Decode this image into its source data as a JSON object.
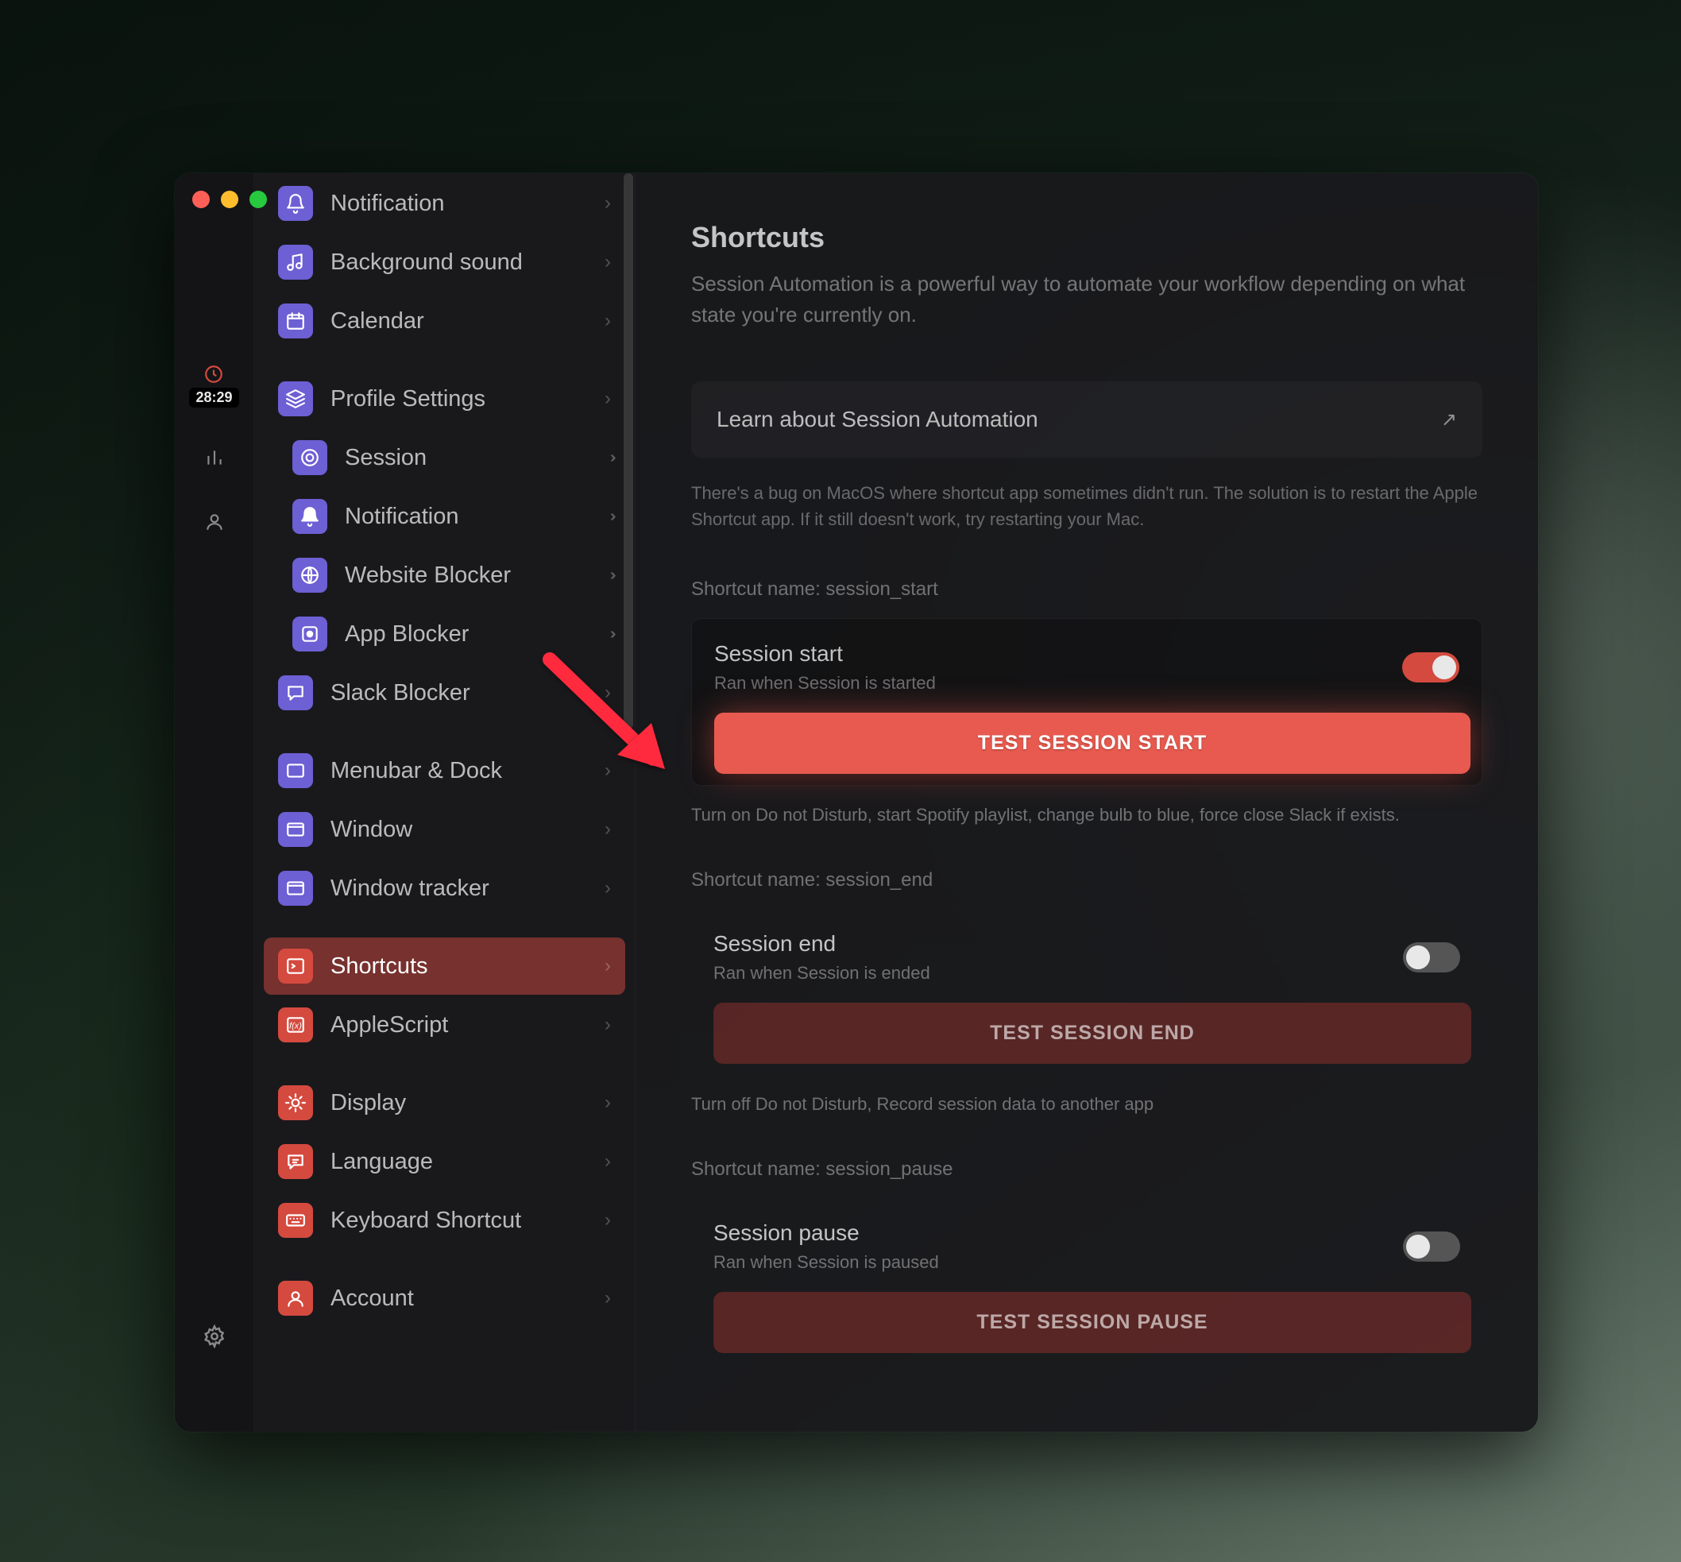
{
  "slim": {
    "timer": "28:29"
  },
  "sidebar": {
    "items": [
      {
        "label": "Notification",
        "icon": "bell-icon",
        "color": "purple",
        "chev": "single"
      },
      {
        "label": "Background sound",
        "icon": "music-icon",
        "color": "purple",
        "chev": "single"
      },
      {
        "label": "Calendar",
        "icon": "calendar-icon",
        "color": "purple",
        "chev": "single"
      },
      {
        "gap": true
      },
      {
        "label": "Profile Settings",
        "icon": "layers-icon",
        "color": "purple",
        "chev": "single"
      },
      {
        "label": "Session",
        "icon": "target-icon",
        "color": "purple",
        "chev": "double",
        "sub": true
      },
      {
        "label": "Notification",
        "icon": "bell-solid-icon",
        "color": "purple",
        "chev": "double",
        "sub": true
      },
      {
        "label": "Website Blocker",
        "icon": "globe-icon",
        "color": "purple",
        "chev": "double",
        "sub": true
      },
      {
        "label": "App Blocker",
        "icon": "app-icon",
        "color": "purple",
        "chev": "double",
        "sub": true
      },
      {
        "label": "Slack Blocker",
        "icon": "chat-icon",
        "color": "purple",
        "chev": "single"
      },
      {
        "gap": true
      },
      {
        "label": "Menubar & Dock",
        "icon": "window-icon",
        "color": "purple",
        "chev": "single"
      },
      {
        "label": "Window",
        "icon": "window2-icon",
        "color": "purple",
        "chev": "single"
      },
      {
        "label": "Window tracker",
        "icon": "window3-icon",
        "color": "purple",
        "chev": "single"
      },
      {
        "gap": true
      },
      {
        "label": "Shortcuts",
        "icon": "terminal-icon",
        "color": "red",
        "chev": "single",
        "active": true
      },
      {
        "label": "AppleScript",
        "icon": "fx-icon",
        "color": "red",
        "chev": "single"
      },
      {
        "gap": true
      },
      {
        "label": "Display",
        "icon": "brightness-icon",
        "color": "red",
        "chev": "single"
      },
      {
        "label": "Language",
        "icon": "speech-icon",
        "color": "red",
        "chev": "single"
      },
      {
        "label": "Keyboard Shortcut",
        "icon": "keyboard-icon",
        "color": "red",
        "chev": "single"
      },
      {
        "gap": true
      },
      {
        "label": "Account",
        "icon": "user-icon",
        "color": "red",
        "chev": "single"
      }
    ]
  },
  "content": {
    "title": "Shortcuts",
    "description": "Session Automation is a powerful way to automate your workflow depending on what state you're currently on.",
    "learn_label": "Learn about Session Automation",
    "bug_note": "There's a bug on MacOS where shortcut app sometimes didn't run. The solution is to restart the Apple Shortcut app. If it still doesn't work, try restarting your Mac.",
    "sections": [
      {
        "name_label": "Shortcut name: session_start",
        "title": "Session start",
        "subtitle": "Ran when Session is started",
        "toggle_on": true,
        "button": "TEST SESSION START",
        "primary": true,
        "highlighted": true,
        "hint": "Turn on Do not Disturb, start Spotify playlist, change bulb to blue, force close Slack if exists."
      },
      {
        "name_label": "Shortcut name: session_end",
        "title": "Session end",
        "subtitle": "Ran when Session is ended",
        "toggle_on": false,
        "button": "TEST SESSION END",
        "primary": false,
        "highlighted": false,
        "hint": "Turn off Do not Disturb, Record session data to another app"
      },
      {
        "name_label": "Shortcut name: session_pause",
        "title": "Session pause",
        "subtitle": "Ran when Session is paused",
        "toggle_on": false,
        "button": "TEST SESSION PAUSE",
        "primary": false,
        "highlighted": false,
        "hint": ""
      }
    ]
  }
}
